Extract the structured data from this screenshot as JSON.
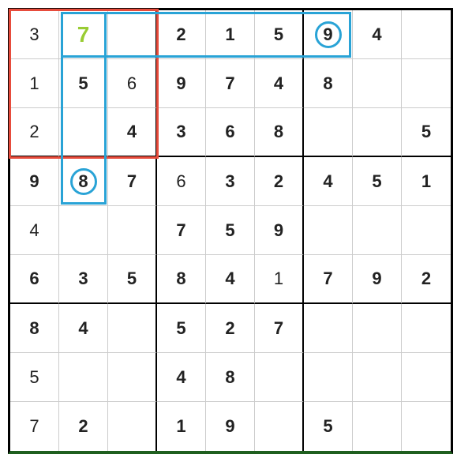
{
  "grid": [
    [
      "3",
      "7",
      "",
      "2",
      "1",
      "5",
      "9",
      "4",
      ""
    ],
    [
      "1",
      "5",
      "6",
      "9",
      "7",
      "4",
      "8",
      "",
      ""
    ],
    [
      "2",
      "",
      "4",
      "3",
      "6",
      "8",
      "",
      "",
      "5"
    ],
    [
      "9",
      "8",
      "7",
      "6",
      "3",
      "2",
      "4",
      "5",
      "1"
    ],
    [
      "4",
      "",
      "",
      "7",
      "5",
      "9",
      "",
      "",
      ""
    ],
    [
      "6",
      "3",
      "5",
      "8",
      "4",
      "1",
      "7",
      "9",
      "2"
    ],
    [
      "8",
      "4",
      "",
      "5",
      "2",
      "7",
      "",
      "",
      ""
    ],
    [
      "5",
      "",
      "",
      "4",
      "8",
      "",
      "",
      "",
      ""
    ],
    [
      "7",
      "2",
      "",
      "1",
      "9",
      "",
      "5",
      "",
      ""
    ]
  ],
  "light_cells": [
    [
      0,
      0
    ],
    [
      1,
      0
    ],
    [
      1,
      2
    ],
    [
      2,
      0
    ],
    [
      3,
      3
    ],
    [
      4,
      0
    ],
    [
      5,
      5
    ],
    [
      7,
      0
    ],
    [
      8,
      0
    ]
  ],
  "highlight_box": {
    "r": 0,
    "c": 0,
    "w": 3,
    "h": 3
  },
  "blue_row_box": {
    "r": 0,
    "c": 1,
    "w": 6,
    "h": 1
  },
  "blue_col_box": {
    "r": 0,
    "c": 1,
    "w": 1,
    "h": 4
  },
  "circles": [
    {
      "r": 0,
      "c": 6
    },
    {
      "r": 3,
      "c": 1
    }
  ],
  "solved_cell": {
    "r": 0,
    "c": 1
  }
}
